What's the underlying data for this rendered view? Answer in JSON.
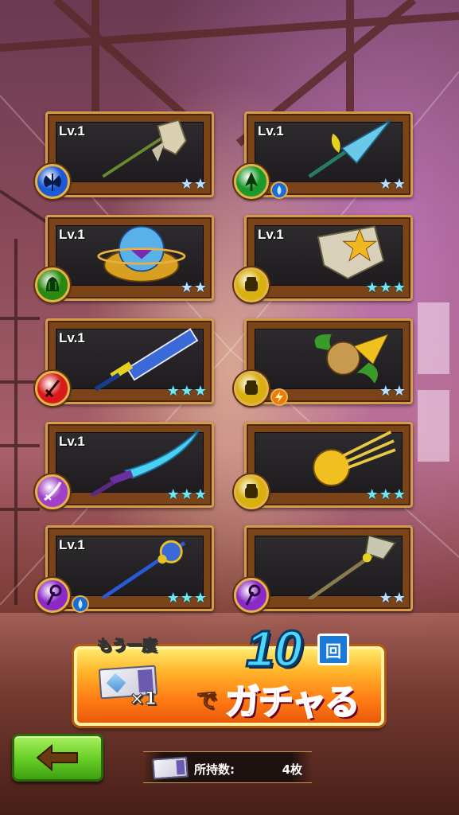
{
  "weapons": [
    {
      "level": "Lv.1",
      "weapon": "axe-icon",
      "type_icon": "axe-type-icon",
      "type_color": "#1a5ad8",
      "element": null,
      "stars": 2,
      "star_color": "silver"
    },
    {
      "level": "Lv.1",
      "weapon": "drill-lance-icon",
      "type_icon": "lance-type-icon",
      "type_color": "#1a9a2a",
      "element": "water-element-icon",
      "stars": 2,
      "star_color": "silver"
    },
    {
      "level": "Lv.1",
      "weapon": "orb-shield-icon",
      "type_icon": "claw-type-icon",
      "type_color": "#2a8a10",
      "element": null,
      "stars": 2,
      "star_color": "silver"
    },
    {
      "level": "Lv.1",
      "weapon": "star-gauntlet-icon",
      "type_icon": "fist-type-icon",
      "type_color": "#d8b010",
      "element": null,
      "stars": 3,
      "star_color": "cyan"
    },
    {
      "level": "Lv.1",
      "weapon": "blue-sword-icon",
      "type_icon": "sword-type-icon",
      "type_color": "#d81a1a",
      "element": null,
      "stars": 3,
      "star_color": "cyan"
    },
    {
      "level": "",
      "weapon": "leaf-gauntlet-icon",
      "type_icon": "fist-type-icon",
      "type_color": "#d8b010",
      "element": "thunder-element-icon",
      "stars": 2,
      "star_color": "silver"
    },
    {
      "level": "Lv.1",
      "weapon": "katana-icon",
      "type_icon": "katana-type-icon",
      "type_color": "#a040c8",
      "element": null,
      "stars": 3,
      "star_color": "cyan"
    },
    {
      "level": "",
      "weapon": "golden-claw-icon",
      "type_icon": "fist-type-icon",
      "type_color": "#d8b010",
      "element": null,
      "stars": 3,
      "star_color": "cyan"
    },
    {
      "level": "Lv.1",
      "weapon": "jewel-staff-icon",
      "type_icon": "staff-type-icon",
      "type_color": "#8a28c8",
      "element": "water-element-icon",
      "stars": 3,
      "star_color": "cyan"
    },
    {
      "level": "",
      "weapon": "eagle-staff-icon",
      "type_icon": "staff-type-icon",
      "type_color": "#8a28c8",
      "element": null,
      "stars": 2,
      "star_color": "silver"
    }
  ],
  "gacha": {
    "again_label": "もう一度",
    "ticket_mult": "×1",
    "count": "10",
    "count_unit": "回",
    "de": "で",
    "action": "ガチャる"
  },
  "owned": {
    "label": "所持数:",
    "value": "4枚"
  },
  "colors": {
    "frame": "#d79a48",
    "gacha_orange": "#ff7a14",
    "back_green": "#6ad028"
  }
}
